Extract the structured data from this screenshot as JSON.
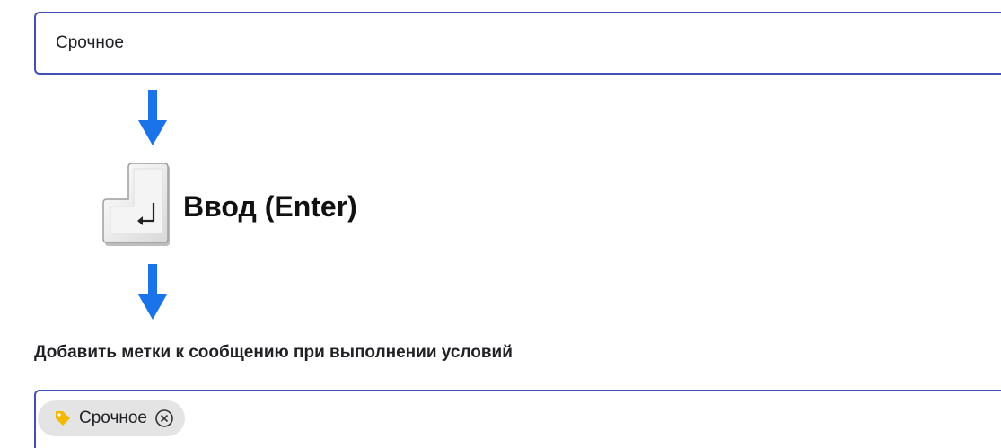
{
  "search_field": {
    "value": "Срочное"
  },
  "key_hint": {
    "label": "Ввод (Enter)",
    "key_glyph": "↲",
    "key_icon": "enter-key-icon"
  },
  "rule_section": {
    "title": "Добавить метки к сообщению при выполнении условий"
  },
  "tags": [
    {
      "label": "Срочное",
      "icon": "tag-icon",
      "icon_color": "#f5b800",
      "remove_icon": "close-circle-icon"
    }
  ],
  "colors": {
    "accent_border": "#3f51b5",
    "arrow": "#1a73e8",
    "chip_background": "#e4e4e4"
  }
}
